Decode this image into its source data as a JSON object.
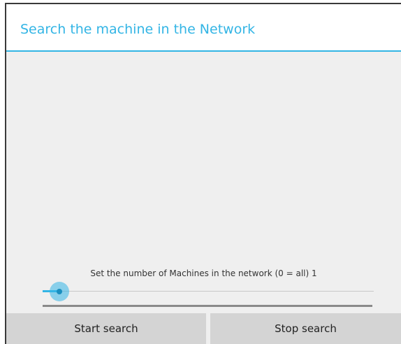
{
  "dialog": {
    "title": "Search the machine in the Network"
  },
  "slider": {
    "label": "Set the number of Machines in the network (0 = all) 1",
    "value_fraction": 0.05
  },
  "buttons": {
    "start_label": "Start search",
    "stop_label": "Stop search"
  },
  "colors": {
    "accent": "#33b5e5",
    "background": "#efefef",
    "button": "#d4d4d4"
  }
}
